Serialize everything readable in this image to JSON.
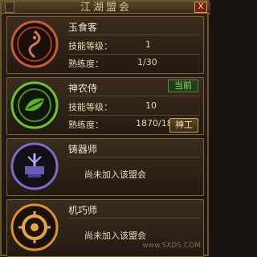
{
  "window": {
    "title": "江湖盟会",
    "close_glyph": "X"
  },
  "guilds": [
    {
      "name": "玉食客",
      "skill_label": "技能等级：",
      "skill_value": "1",
      "proficiency_label": "熟练度：",
      "proficiency_value": "1/30",
      "emblem": "serpent-emblem-icon",
      "color": "#c65a3a"
    },
    {
      "name": "神农侍",
      "badge": "当前",
      "skill_label": "技能等级：",
      "skill_value": "10",
      "proficiency_label": "熟练度：",
      "proficiency_value": "1870/1870",
      "button": "神工",
      "emblem": "herb-emblem-icon",
      "color": "#6fbf3a"
    },
    {
      "name": "铸器师",
      "status": "尚未加入该盟会",
      "emblem": "forge-emblem-icon",
      "color": "#7b6cc7"
    },
    {
      "name": "机巧师",
      "status": "尚未加入该盟会",
      "emblem": "gear-emblem-icon",
      "color": "#d8932e"
    }
  ],
  "watermark": "www.SXDS.COM"
}
